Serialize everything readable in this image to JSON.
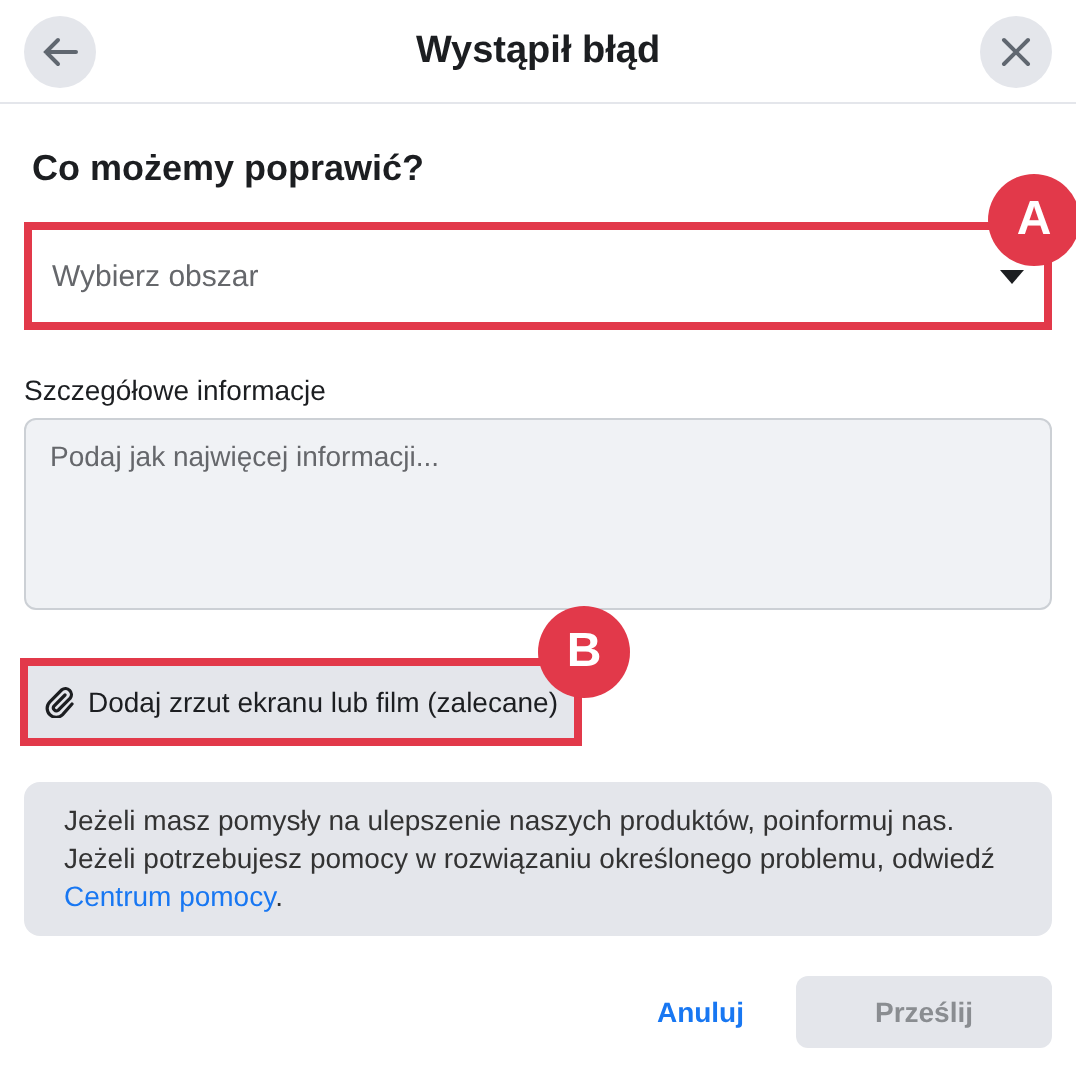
{
  "header": {
    "title": "Wystąpił błąd"
  },
  "heading": "Co możemy poprawić?",
  "area_select": {
    "placeholder": "Wybierz obszar",
    "callout": "A"
  },
  "details": {
    "label": "Szczegółowe informacje",
    "placeholder": "Podaj jak najwięcej informacji..."
  },
  "attach_button": {
    "label": "Dodaj zrzut ekranu lub film (zalecane)",
    "callout": "B"
  },
  "info": {
    "text": "Jeżeli masz pomysły na ulepszenie naszych produktów, poinformuj nas. Jeżeli potrzebujesz pomocy w rozwiązaniu określonego problemu, odwiedź ",
    "link": "Centrum pomocy",
    "text_after": "."
  },
  "buttons": [
    {
      "label": "Anuluj",
      "kind": "link",
      "disabled": false
    },
    {
      "label": "Prześlij",
      "kind": "primary",
      "disabled": true
    }
  ]
}
